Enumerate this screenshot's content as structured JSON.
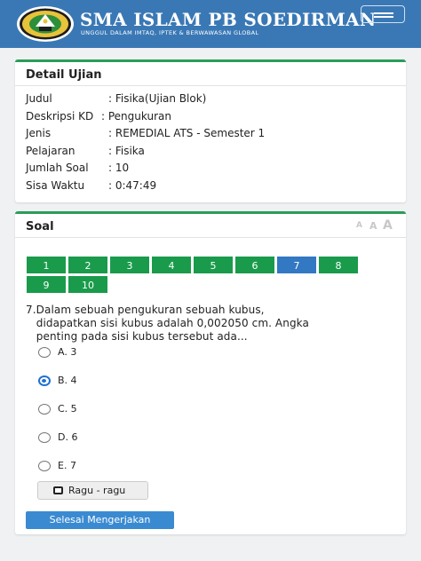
{
  "header": {
    "school_name": "SMA ISLAM PB SOEDIRMAN",
    "tagline": "UNGGUL DALAM IMTAQ, IPTEK & BERWAWASAN GLOBAL"
  },
  "detail": {
    "title": "Detail Ujian",
    "rows": [
      {
        "label": "Judul",
        "value": ": Fisika(Ujian Blok)"
      },
      {
        "label": "Deskripsi KD",
        "value": ": Pengukuran"
      },
      {
        "label": "Jenis",
        "value": ": REMEDIAL ATS - Semester 1"
      },
      {
        "label": "Pelajaran",
        "value": ": Fisika"
      },
      {
        "label": "Jumlah Soal",
        "value": ": 10"
      },
      {
        "label": "Sisa Waktu",
        "value": ": 0:47:49"
      }
    ]
  },
  "soal": {
    "title": "Soal",
    "font_controls": [
      "A",
      "A",
      "A"
    ],
    "numbers": [
      "1",
      "2",
      "3",
      "4",
      "5",
      "6",
      "7",
      "8",
      "9",
      "10"
    ],
    "active_number": "7",
    "question_lines": [
      "7.Dalam sebuah pengukuran sebuah kubus,",
      "   didapatkan sisi kubus adalah 0,002050 cm. Angka",
      "   penting pada sisi kubus tersebut ada..."
    ],
    "options": [
      {
        "label": "A. 3",
        "checked": false
      },
      {
        "label": "B. 4",
        "checked": true
      },
      {
        "label": "C. 5",
        "checked": false
      },
      {
        "label": "D. 6",
        "checked": false
      },
      {
        "label": "E. 7",
        "checked": false
      }
    ],
    "ragu_label": "Ragu - ragu",
    "finish_label": "Selesai Mengerjakan"
  },
  "colors": {
    "header_bg": "#3a78b5",
    "card_accent": "#2a9d58",
    "number_button": "#1a9b4b",
    "active_number": "#3378c2",
    "finish_button": "#3a8ad1"
  }
}
